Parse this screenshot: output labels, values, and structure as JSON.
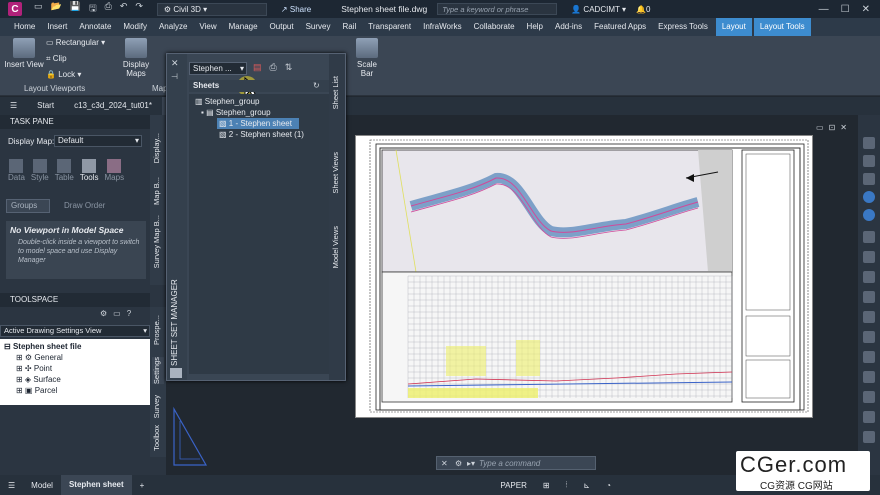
{
  "titlebar": {
    "app_letter": "C",
    "workspace": "Civil 3D",
    "share": "Share",
    "filename": "Stephen sheet file.dwg",
    "search_placeholder": "Type a keyword or phrase",
    "user": "CADCIMT",
    "notification_count": "0"
  },
  "menu": [
    "Home",
    "Insert",
    "Annotate",
    "Modify",
    "Analyze",
    "View",
    "Manage",
    "Output",
    "Survey",
    "Rail",
    "Transparent",
    "InfraWorks",
    "Collaborate",
    "Help",
    "Add-ins",
    "Featured Apps",
    "Express Tools"
  ],
  "menu_context": [
    "Layout",
    "Layout Tools"
  ],
  "ribbon": {
    "insert_view": "Insert View",
    "rectangular": "Rectangular",
    "clip": "Clip",
    "lock": "Lock",
    "display_maps": "Display Maps",
    "scale_bar": "Scale Bar",
    "panel_layout_viewports": "Layout Viewports",
    "panel_map": "Map"
  },
  "filetabs": [
    "Start",
    "c13_c3d_2024_tut01*",
    "St"
  ],
  "taskpane": {
    "title": "TASK PANE",
    "display_map_label": "Display Map:",
    "display_map_value": "Default",
    "tools": [
      "Data",
      "Style",
      "Table",
      "Tools",
      "Maps"
    ],
    "groups": "Groups",
    "draw_order": "Draw Order",
    "no_viewport_title": "No Viewport in Model Space",
    "no_viewport_text": "Double-click inside a viewport to switch to model space and use Display Manager",
    "side_tabs": [
      "Display...",
      "Map B...",
      "Map B...",
      "Survey"
    ]
  },
  "toolspace": {
    "title": "TOOLSPACE",
    "view_select": "Active Drawing Settings View",
    "tree": [
      "Stephen sheet file",
      "General",
      "Point",
      "Surface",
      "Parcel"
    ],
    "side_tabs": [
      "Prospe...",
      "Settings",
      "Survey",
      "Toolbox"
    ]
  },
  "ssm": {
    "title": "SHEET SET MANAGER",
    "dropdown": "Stephen ...",
    "sheets_header": "Sheets",
    "tree": [
      "Stephen_group",
      "Stephen_group",
      "1 - Stephen sheet",
      "2 - Stephen sheet (1)"
    ],
    "vtabs": [
      "Sheet List",
      "Sheet Views",
      "Model Views"
    ]
  },
  "statusbar": {
    "model": "Model",
    "layout": "Stephen sheet",
    "paper": "PAPER"
  },
  "cmdline_placeholder": "Type a command",
  "watermark": {
    "line1": "CGer.com",
    "line2": "CG资源 CG网站"
  }
}
